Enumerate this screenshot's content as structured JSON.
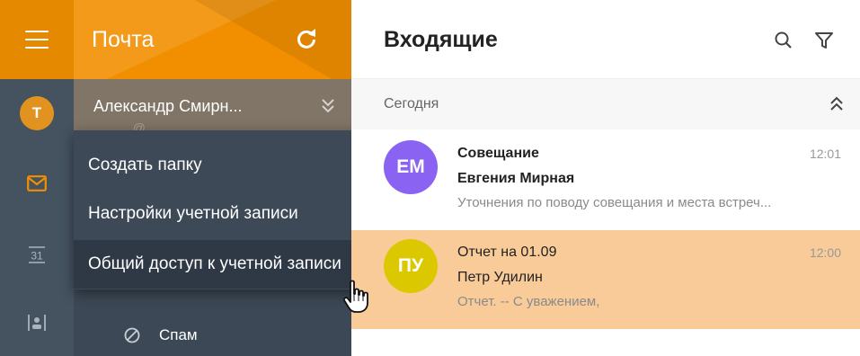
{
  "app": {
    "title": "Почта",
    "user_initial": "Т"
  },
  "account": {
    "name": "Александр Смирн...",
    "email": "...@..."
  },
  "context_menu": {
    "items": [
      {
        "label": "Создать папку"
      },
      {
        "label": "Настройки учетной записи"
      },
      {
        "label": "Общий доступ к учетной записи"
      }
    ],
    "hovered_index": 2
  },
  "folders": {
    "spam_label": "Спам"
  },
  "inbox": {
    "title": "Входящие",
    "group_label": "Сегодня",
    "messages": [
      {
        "initials": "ЕМ",
        "subject": "Совещание",
        "sender": "Евгения Мирная",
        "time": "12:01",
        "preview": "Уточнения по поводу совещания и места встреч...",
        "unread": true,
        "avatar_color": "#8b63f2"
      },
      {
        "initials": "ПУ",
        "subject": "Отчет на 01.09",
        "sender": "Петр Удилин",
        "time": "12:00",
        "preview": "Отчет. -- С уважением,",
        "unread": false,
        "avatar_color": "#dcc800"
      }
    ]
  },
  "colors": {
    "accent_orange": "#f28f00",
    "sidebar_dark": "#3c4855",
    "selected_row": "#f9cb98"
  },
  "icons": [
    "menu-icon",
    "refresh-icon",
    "mail-icon",
    "calendar-icon",
    "contacts-icon",
    "chevron-double-down-icon",
    "spam-icon",
    "search-icon",
    "filter-icon",
    "chevron-double-up-icon",
    "hand-pointer-icon"
  ]
}
